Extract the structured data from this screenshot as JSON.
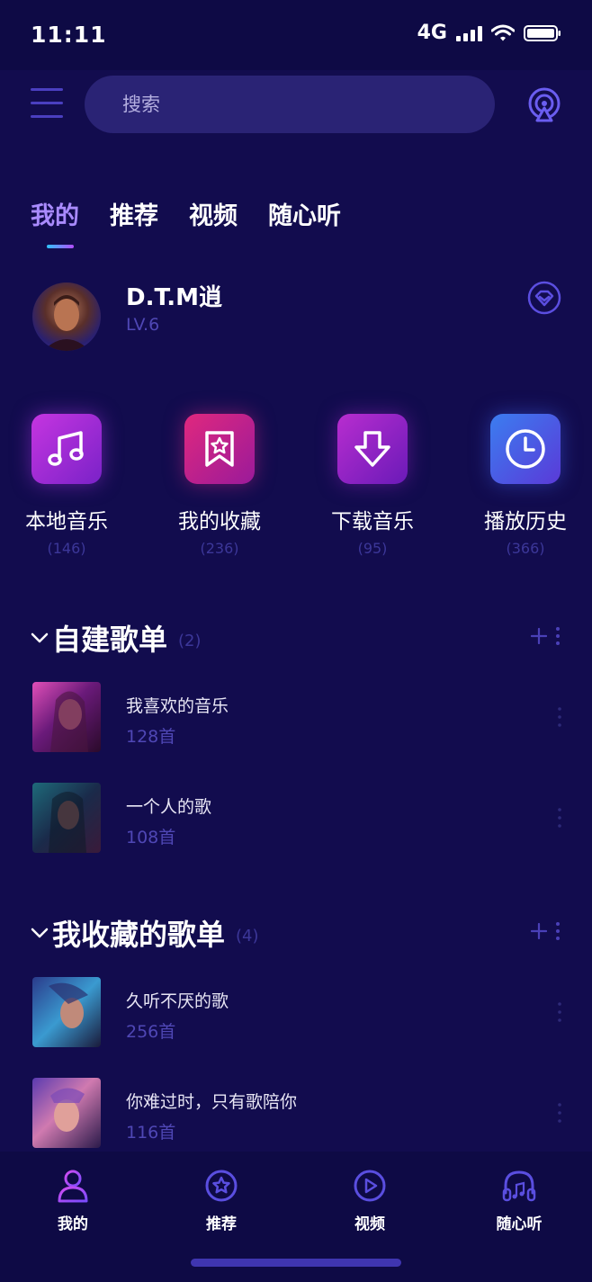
{
  "status_bar": {
    "time": "11:11",
    "network": "4G"
  },
  "header": {
    "search_placeholder": "搜索"
  },
  "tabs": [
    {
      "label": "我的",
      "active": true
    },
    {
      "label": "推荐",
      "active": false
    },
    {
      "label": "视频",
      "active": false
    },
    {
      "label": "随心听",
      "active": false
    }
  ],
  "profile": {
    "name": "D.T.M逍",
    "level": "LV.6"
  },
  "quick_access": [
    {
      "label": "本地音乐",
      "count": "(146)",
      "icon": "music-note-icon",
      "color": "#a230d8"
    },
    {
      "label": "我的收藏",
      "count": "(236)",
      "icon": "star-bookmark-icon",
      "color": "#c2237f"
    },
    {
      "label": "下载音乐",
      "count": "(95)",
      "icon": "download-arrow-icon",
      "color": "#8a1fb5"
    },
    {
      "label": "播放历史",
      "count": "(366)",
      "icon": "clock-icon",
      "color": "#3a56d8"
    }
  ],
  "sections": {
    "created": {
      "title": "自建歌单",
      "count": "(2)",
      "playlists": [
        {
          "name": "我喜欢的音乐",
          "count": "128首"
        },
        {
          "name": "一个人的歌",
          "count": "108首"
        }
      ]
    },
    "collected": {
      "title": "我收藏的歌单",
      "count": "(4)",
      "playlists": [
        {
          "name": "久听不厌的歌",
          "count": "256首"
        },
        {
          "name": "你难过时，只有歌陪你",
          "count": "116首"
        }
      ]
    }
  },
  "bottom_nav": [
    {
      "label": "我的",
      "icon": "user-icon",
      "active": true
    },
    {
      "label": "推荐",
      "icon": "star-circle-icon",
      "active": false
    },
    {
      "label": "视频",
      "icon": "play-circle-icon",
      "active": false
    },
    {
      "label": "随心听",
      "icon": "headphones-icon",
      "active": false
    }
  ],
  "colors": {
    "background": "#120c4e",
    "accent": "#a98bff",
    "muted": "#4f47b5"
  }
}
